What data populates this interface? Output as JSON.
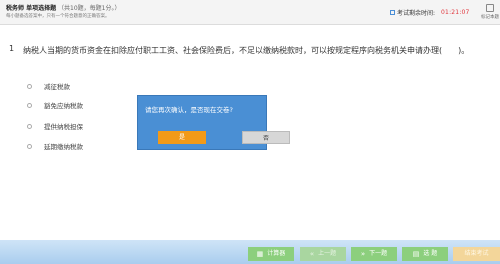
{
  "header": {
    "title": "税务师 单项选择题",
    "subtitle": "（共10题，每题1分。）",
    "description": "每小题备选答案中，只有一个符合题意的正确答案。",
    "timer_label": "考试剩余时间:",
    "timer_value": "01:21:07",
    "flag_label": "标记本题"
  },
  "question": {
    "number": "1",
    "text": "纳税人当期的货币资金在扣除应付职工工资、社会保险费后，不足以缴纳税款时，可以按规定程序向税务机关申请办理(　　)。",
    "options": [
      "减征税款",
      "豁免应纳税款",
      "提供纳税担保",
      "延期缴纳税款"
    ]
  },
  "dialog": {
    "message": "请您再次确认，是否现在交卷?",
    "yes_label": "是",
    "no_label": "否"
  },
  "footer": {
    "calculator_label": "计算器",
    "prev_label": "上一题",
    "next_label": "下一题",
    "select_label": "选 题",
    "end_label": "结束考试"
  }
}
